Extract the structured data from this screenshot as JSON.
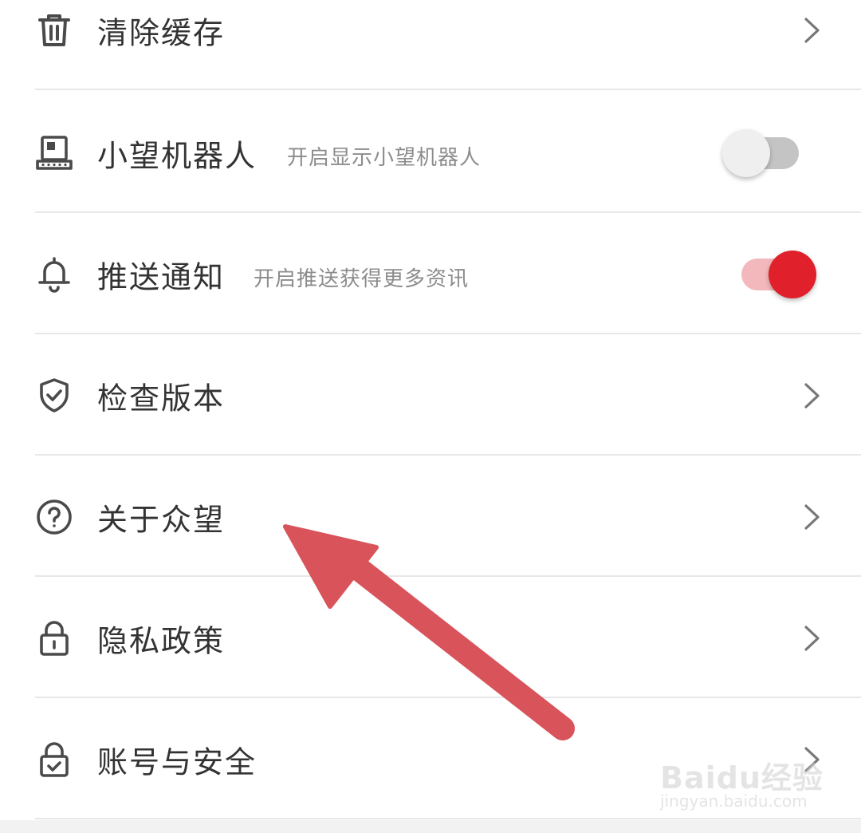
{
  "settings": {
    "items": [
      {
        "label": "清除缓存",
        "subtitle": "",
        "icon": "trash-icon",
        "control": "chevron"
      },
      {
        "label": "小望机器人",
        "subtitle": "开启显示小望机器人",
        "icon": "robot-icon",
        "control": "toggle",
        "toggle_on": false
      },
      {
        "label": "推送通知",
        "subtitle": "开启推送获得更多资讯",
        "icon": "bell-icon",
        "control": "toggle",
        "toggle_on": true
      },
      {
        "label": "检查版本",
        "subtitle": "",
        "icon": "shield-check-icon",
        "control": "chevron"
      },
      {
        "label": "关于众望",
        "subtitle": "",
        "icon": "help-circle-icon",
        "control": "chevron"
      },
      {
        "label": "隐私政策",
        "subtitle": "",
        "icon": "lock-icon",
        "control": "chevron"
      },
      {
        "label": "账号与安全",
        "subtitle": "",
        "icon": "lock-check-icon",
        "control": "chevron"
      }
    ]
  },
  "colors": {
    "accent": "#e0202a",
    "accent_track": "#f3b8bb",
    "toggle_off_knob": "#efefef",
    "toggle_off_track": "#c4c4c4",
    "icon": "#4a4a4a",
    "text": "#333333",
    "subtext": "#8c8c8c",
    "annotation_arrow": "#d9535b"
  },
  "watermark": {
    "brand": "Baidu经验",
    "url": "jingyan.baidu.com"
  }
}
